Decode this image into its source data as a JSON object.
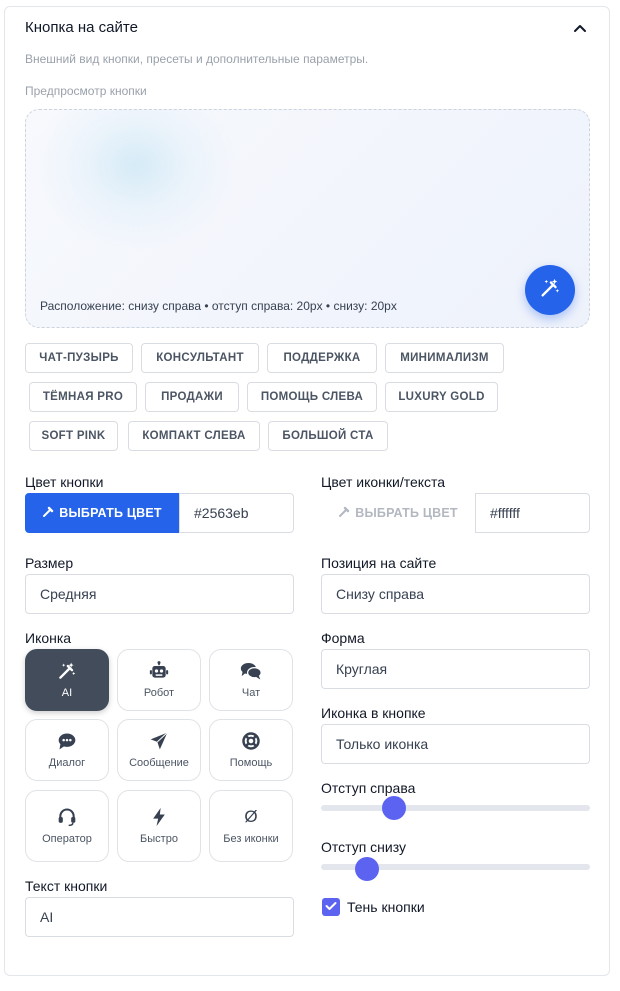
{
  "card": {
    "title": "Кнопка на сайте",
    "subtitle": "Внешний вид кнопки, пресеты и дополнительные параметры.",
    "preview_label": "Предпросмотр кнопки"
  },
  "preview": {
    "caption": "Расположение: снизу справа • отступ справа: 20px • снизу: 20px",
    "fab_icon": "magic-wand-icon",
    "fab_color": "#2563eb"
  },
  "presets": [
    "ЧАТ-ПУЗЫРЬ",
    "КОНСУЛЬТАНТ",
    "ПОДДЕРЖКА",
    "МИНИМАЛИЗМ",
    "ТЁМНАЯ PRO",
    "ПРОДАЖИ",
    "ПОМОЩЬ СЛЕВА",
    "LUXURY GOLD",
    "SOFT PINK",
    "КОМПАКТ СЛЕВА",
    "БОЛЬШОЙ СТА"
  ],
  "button_color": {
    "label": "Цвет кнопки",
    "pick_label": "ВЫБРАТЬ ЦВЕТ",
    "value": "#2563eb"
  },
  "icon_color": {
    "label": "Цвет иконки/текста",
    "pick_label": "ВЫБРАТЬ ЦВЕТ",
    "value": "#ffffff"
  },
  "size": {
    "label": "Размер",
    "value": "Средняя"
  },
  "position": {
    "label": "Позиция на сайте",
    "value": "Снизу справа"
  },
  "icon_section": {
    "label": "Иконка",
    "options": [
      {
        "label": "AI",
        "icon": "magic-wand-icon",
        "selected": true
      },
      {
        "label": "Робот",
        "icon": "robot-icon",
        "selected": false
      },
      {
        "label": "Чат",
        "icon": "chat-bubbles-icon",
        "selected": false
      },
      {
        "label": "Диалог",
        "icon": "dialog-bubble-icon",
        "selected": false
      },
      {
        "label": "Сообщение",
        "icon": "paper-plane-icon",
        "selected": false
      },
      {
        "label": "Помощь",
        "icon": "lifebuoy-icon",
        "selected": false
      },
      {
        "label": "Оператор",
        "icon": "headset-icon",
        "selected": false
      },
      {
        "label": "Быстро",
        "icon": "lightning-icon",
        "selected": false
      },
      {
        "label": "Без иконки",
        "icon": "no-icon-symbol",
        "glyph": "Ø",
        "selected": false
      }
    ]
  },
  "shape": {
    "label": "Форма",
    "value": "Круглая"
  },
  "icon_in_button": {
    "label": "Иконка в кнопке",
    "value": "Только иконка"
  },
  "offset_right": {
    "label": "Отступ справа",
    "value_fraction": 0.27
  },
  "offset_bottom": {
    "label": "Отступ снизу",
    "value_fraction": 0.17
  },
  "button_text": {
    "label": "Текст кнопки",
    "value": "AI"
  },
  "shadow": {
    "label": "Тень кнопки",
    "checked": true
  },
  "colors": {
    "accent": "#2563eb",
    "slider": "#5b63f0",
    "tile_active": "#434c5a"
  }
}
